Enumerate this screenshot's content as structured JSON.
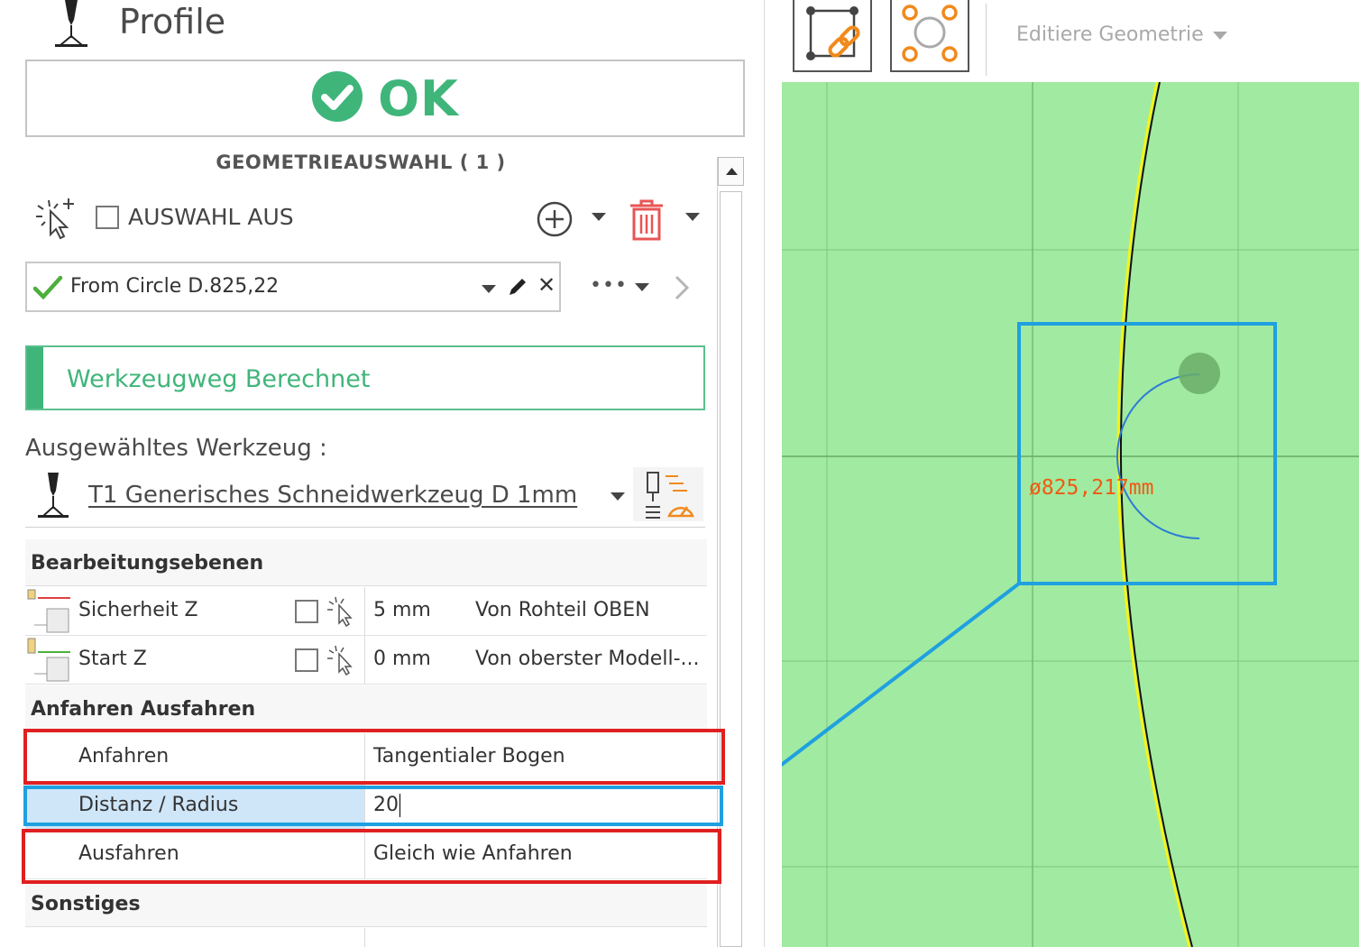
{
  "header": {
    "title": "Profile"
  },
  "ok_button": {
    "label": "OK"
  },
  "geometry_selection": {
    "title": "GEOMETRIEAUSWAHL ( 1 )",
    "select_off_label": "AUSWAHL AUS",
    "item": {
      "label": "From Circle D.825,22"
    },
    "more_label": "•••"
  },
  "status": {
    "label": "Werkzeugweg Berechnet"
  },
  "tool": {
    "heading": "Ausgewähltes Werkzeug :",
    "name": "T1 Generisches Schneidwerkzeug D 1mm"
  },
  "properties": {
    "sections": {
      "levels": "Bearbeitungsebenen",
      "approach": "Anfahren Ausfahren",
      "misc": "Sonstiges"
    },
    "rows": {
      "safety_z": {
        "name": "Sicherheit Z",
        "value": "5 mm",
        "reference": "Von Rohteil OBEN"
      },
      "start_z": {
        "name": "Start Z",
        "value": "0 mm",
        "reference": "Von oberster Modell-..."
      },
      "approach": {
        "name": "Anfahren",
        "value": "Tangentialer Bogen"
      },
      "distance": {
        "name": "Distanz / Radius",
        "value": "20"
      },
      "retract": {
        "name": "Ausfahren",
        "value": "Gleich wie Anfahren"
      }
    }
  },
  "toolbar": {
    "edit_geometry_label": "Editiere Geometrie"
  },
  "viewport": {
    "dimension_label": "ø825,217mm"
  },
  "colors": {
    "ok_green": "#3fb57a",
    "viewport_bg": "#a1eaa1",
    "highlight_red": "#e02020",
    "highlight_blue": "#1fa0e0",
    "dimension_text": "#f05a14",
    "toolbar_orange": "#f08a1c"
  }
}
